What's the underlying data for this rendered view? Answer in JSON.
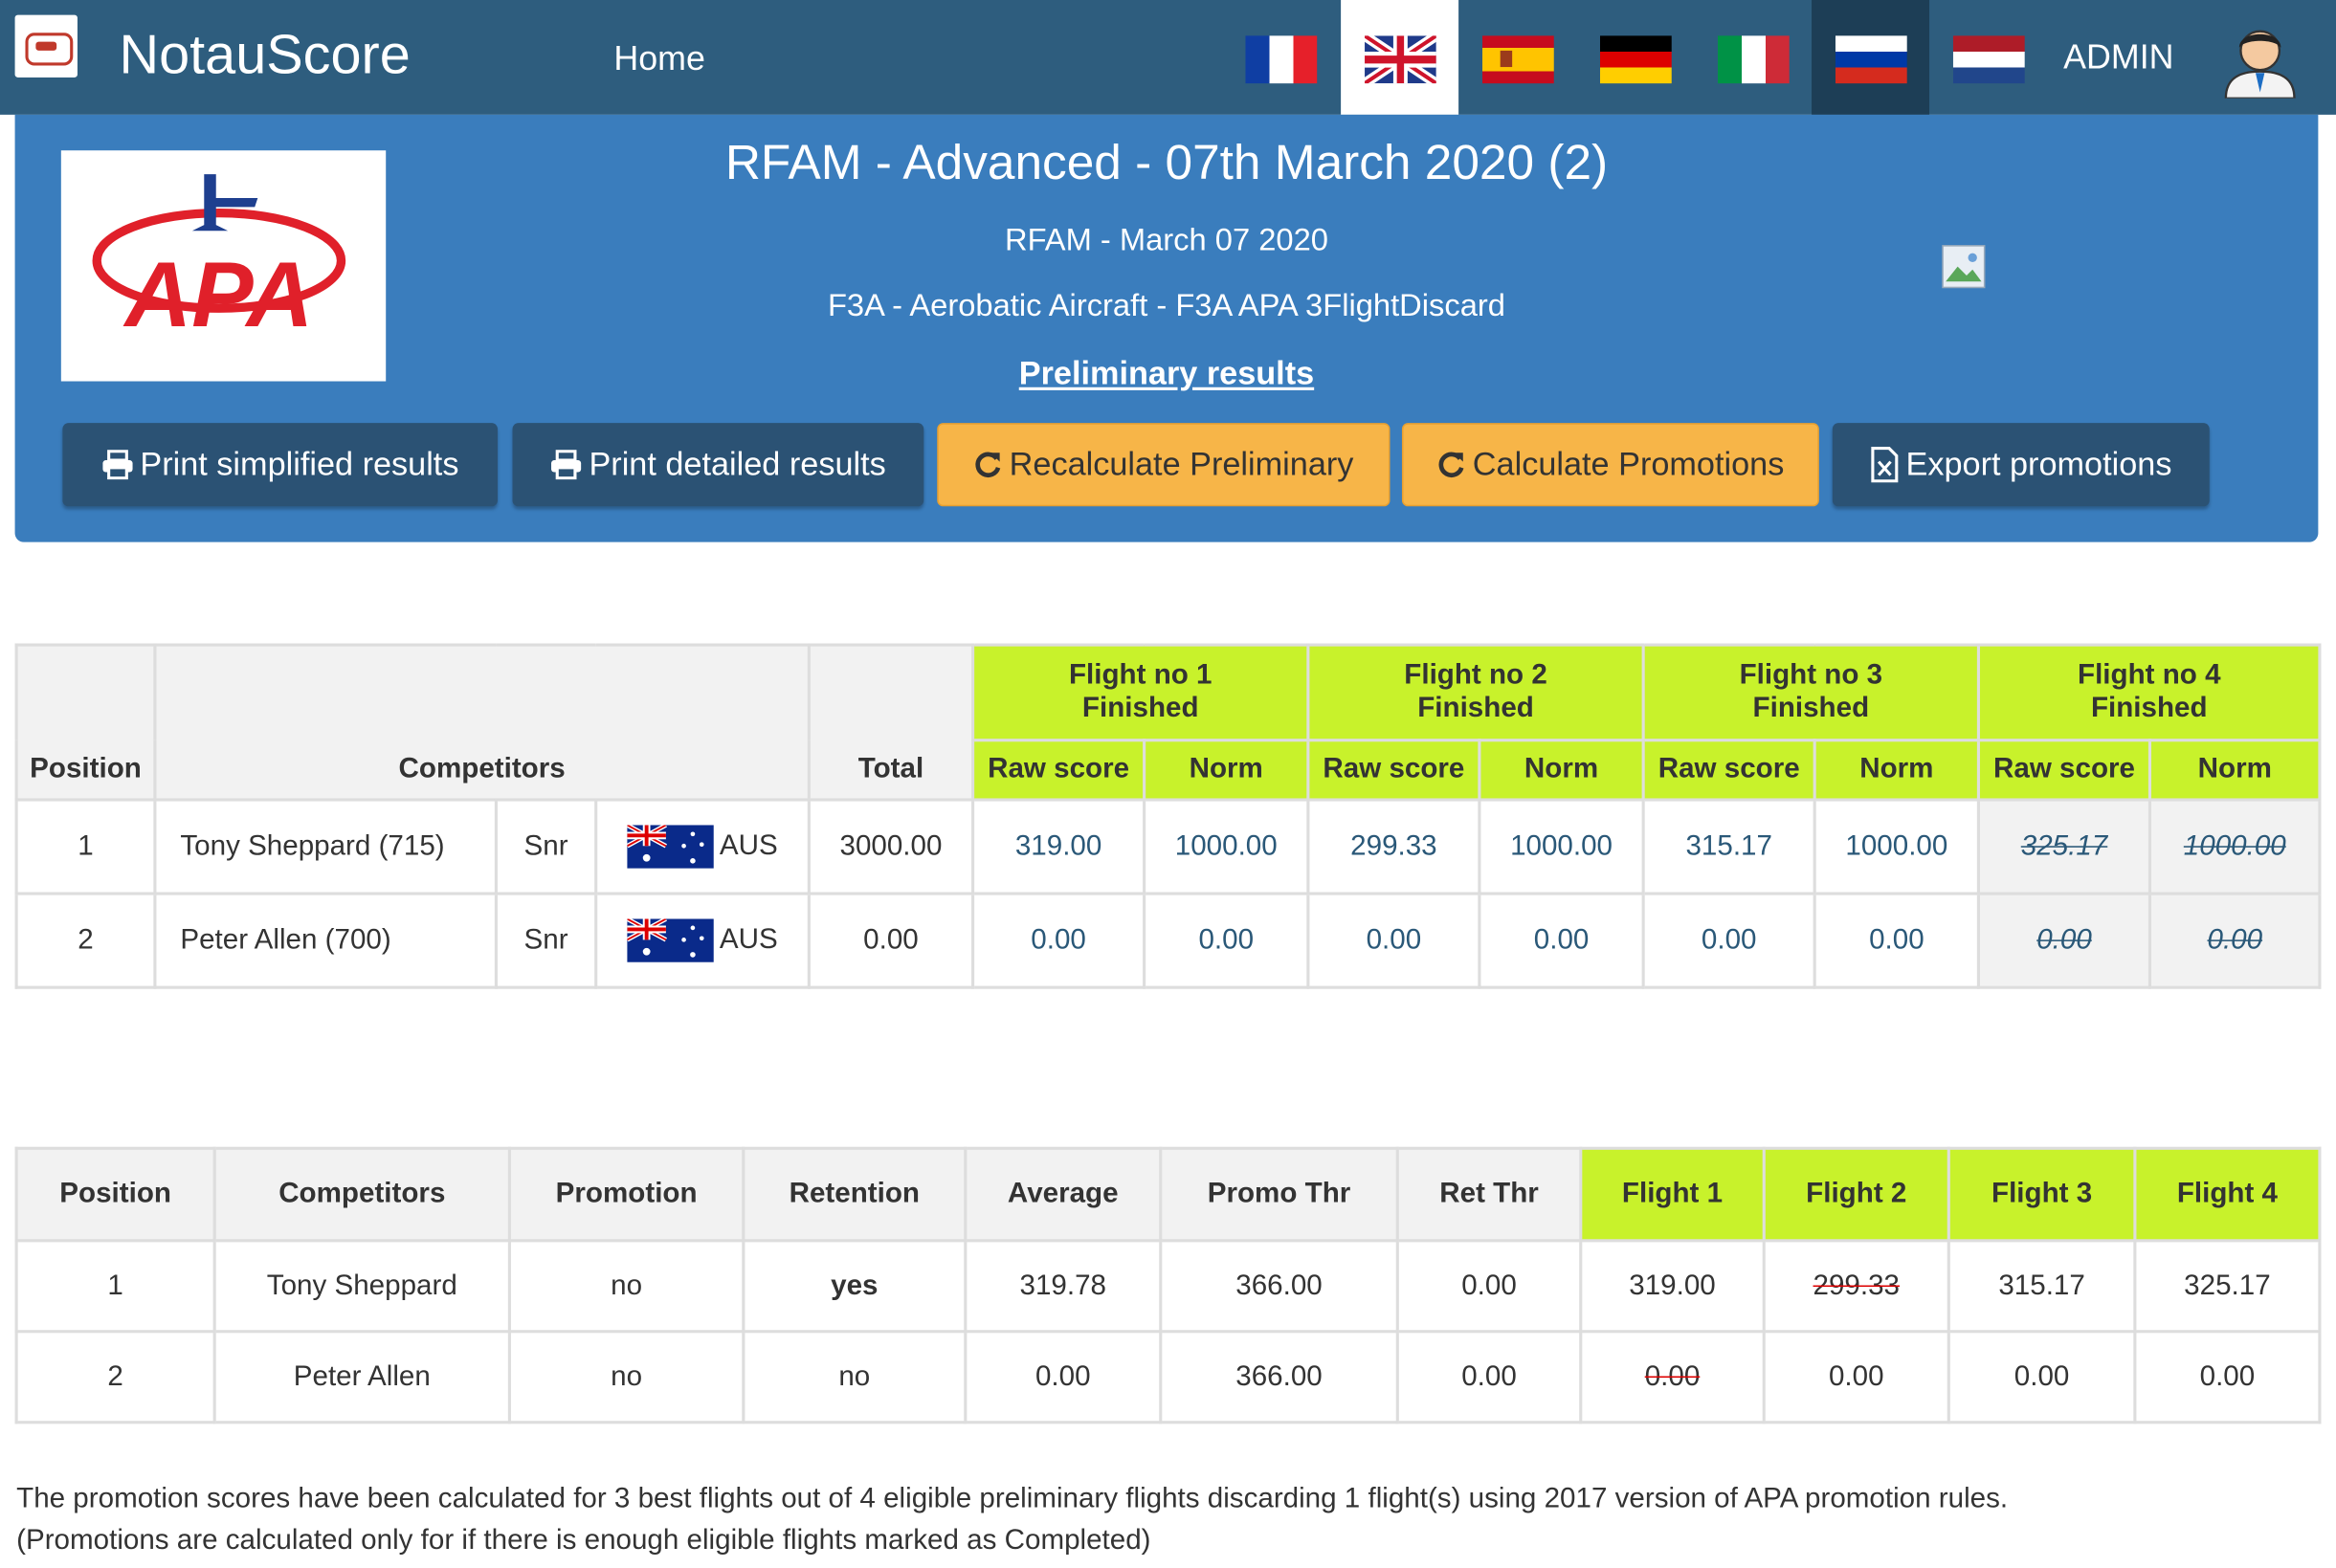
{
  "nav": {
    "brand": "NotauScore",
    "home": "Home",
    "flags": [
      "flag-france-icon",
      "flag-uk-icon",
      "flag-spain-icon",
      "flag-germany-icon",
      "flag-italy-icon",
      "flag-russia-icon",
      "flag-netherlands-icon"
    ],
    "admin": "ADMIN"
  },
  "header": {
    "title": "RFAM - Advanced - 07th March 2020 (2)",
    "subtitle": "RFAM - March 07 2020",
    "category": "F3A - Aerobatic Aircraft - F3A APA 3FlightDiscard",
    "status": "Preliminary results",
    "logo_text": "APA"
  },
  "buttons": {
    "print_simplified": "Print simplified results",
    "print_detailed": "Print detailed results",
    "recalculate": "Recalculate Preliminary",
    "calculate_promotions": "Calculate Promotions",
    "export_promotions": "Export promotions"
  },
  "results": {
    "col_position": "Position",
    "col_competitors": "Competitors",
    "col_total": "Total",
    "flights": [
      {
        "title": "Flight no 1",
        "status": "Finished"
      },
      {
        "title": "Flight no 2",
        "status": "Finished"
      },
      {
        "title": "Flight no 3",
        "status": "Finished"
      },
      {
        "title": "Flight no 4",
        "status": "Finished"
      }
    ],
    "raw_label": "Raw score",
    "norm_label": "Norm",
    "rows": [
      {
        "position": "1",
        "name": "Tony Sheppard (715)",
        "class": "Snr",
        "country": "AUS",
        "total": "3000.00",
        "scores": [
          "319.00",
          "1000.00",
          "299.33",
          "1000.00",
          "315.17",
          "1000.00",
          "325.17",
          "1000.00"
        ]
      },
      {
        "position": "2",
        "name": "Peter Allen (700)",
        "class": "Snr",
        "country": "AUS",
        "total": "0.00",
        "scores": [
          "0.00",
          "0.00",
          "0.00",
          "0.00",
          "0.00",
          "0.00",
          "0.00",
          "0.00"
        ]
      }
    ]
  },
  "promotions": {
    "headers": [
      "Position",
      "Competitors",
      "Promotion",
      "Retention",
      "Average",
      "Promo Thr",
      "Ret Thr",
      "Flight 1",
      "Flight 2",
      "Flight 3",
      "Flight 4"
    ],
    "rows": [
      [
        "1",
        "Tony Sheppard",
        "no",
        "yes",
        "319.78",
        "366.00",
        "0.00",
        "319.00",
        "299.33",
        "315.17",
        "325.17"
      ],
      [
        "2",
        "Peter Allen",
        "no",
        "no",
        "0.00",
        "366.00",
        "0.00",
        "0.00",
        "0.00",
        "0.00",
        "0.00"
      ]
    ]
  },
  "footer": {
    "line1": "The promotion scores have been calculated for 3 best flights out of 4 eligible preliminary flights discarding 1 flight(s) using 2017 version of APA promotion rules.",
    "line2": "(Promotions are calculated only for if there is enough eligible flights marked as Completed)"
  }
}
